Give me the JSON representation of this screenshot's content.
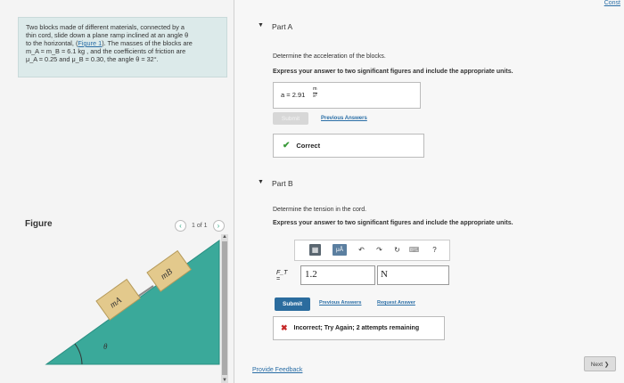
{
  "problem": {
    "line1": "Two blocks made of different materials, connected by a",
    "line2": "thin cord, slide down a plane ramp inclined at an angle θ",
    "line3_pre": "to the horizontal, (",
    "line3_link": "Figure 1",
    "line3_post": "). The masses of the blocks are",
    "line4": "m_A = m_B = 6.1  kg , and the coefficients of friction are",
    "line5": "μ_A = 0.25 and μ_B = 0.30, the angle θ = 32°."
  },
  "figure": {
    "label": "Figure",
    "pager_text": "1 of 1",
    "block_a_label": "mA",
    "block_b_label": "mB",
    "angle_label": "θ"
  },
  "header": {
    "corner_link": "Const"
  },
  "part_a": {
    "title": "Part A",
    "prompt": "Determine the acceleration of the blocks.",
    "instruction": "Express your answer to two significant figures and include the appropriate units.",
    "answer_lhs": "a = 2.91",
    "unit_num": "m",
    "unit_den": "s²",
    "submit_label": "Submit",
    "previous_answers": "Previous Answers",
    "result": "Correct"
  },
  "part_b": {
    "title": "Part B",
    "prompt": "Determine the tension in the cord.",
    "instruction": "Express your answer to two significant figures and include the appropriate units.",
    "var_label": "F_T =",
    "value": "1.2",
    "unit": "N",
    "submit_label": "Submit",
    "previous_answers": "Previous Answers",
    "request_answer": "Request Answer",
    "result": "Incorrect; Try Again; 2 attempts remaining",
    "toolbar_mu": "μÅ",
    "toolbar_help": "?"
  },
  "footer": {
    "feedback": "Provide Feedback",
    "next": "Next ❯"
  }
}
